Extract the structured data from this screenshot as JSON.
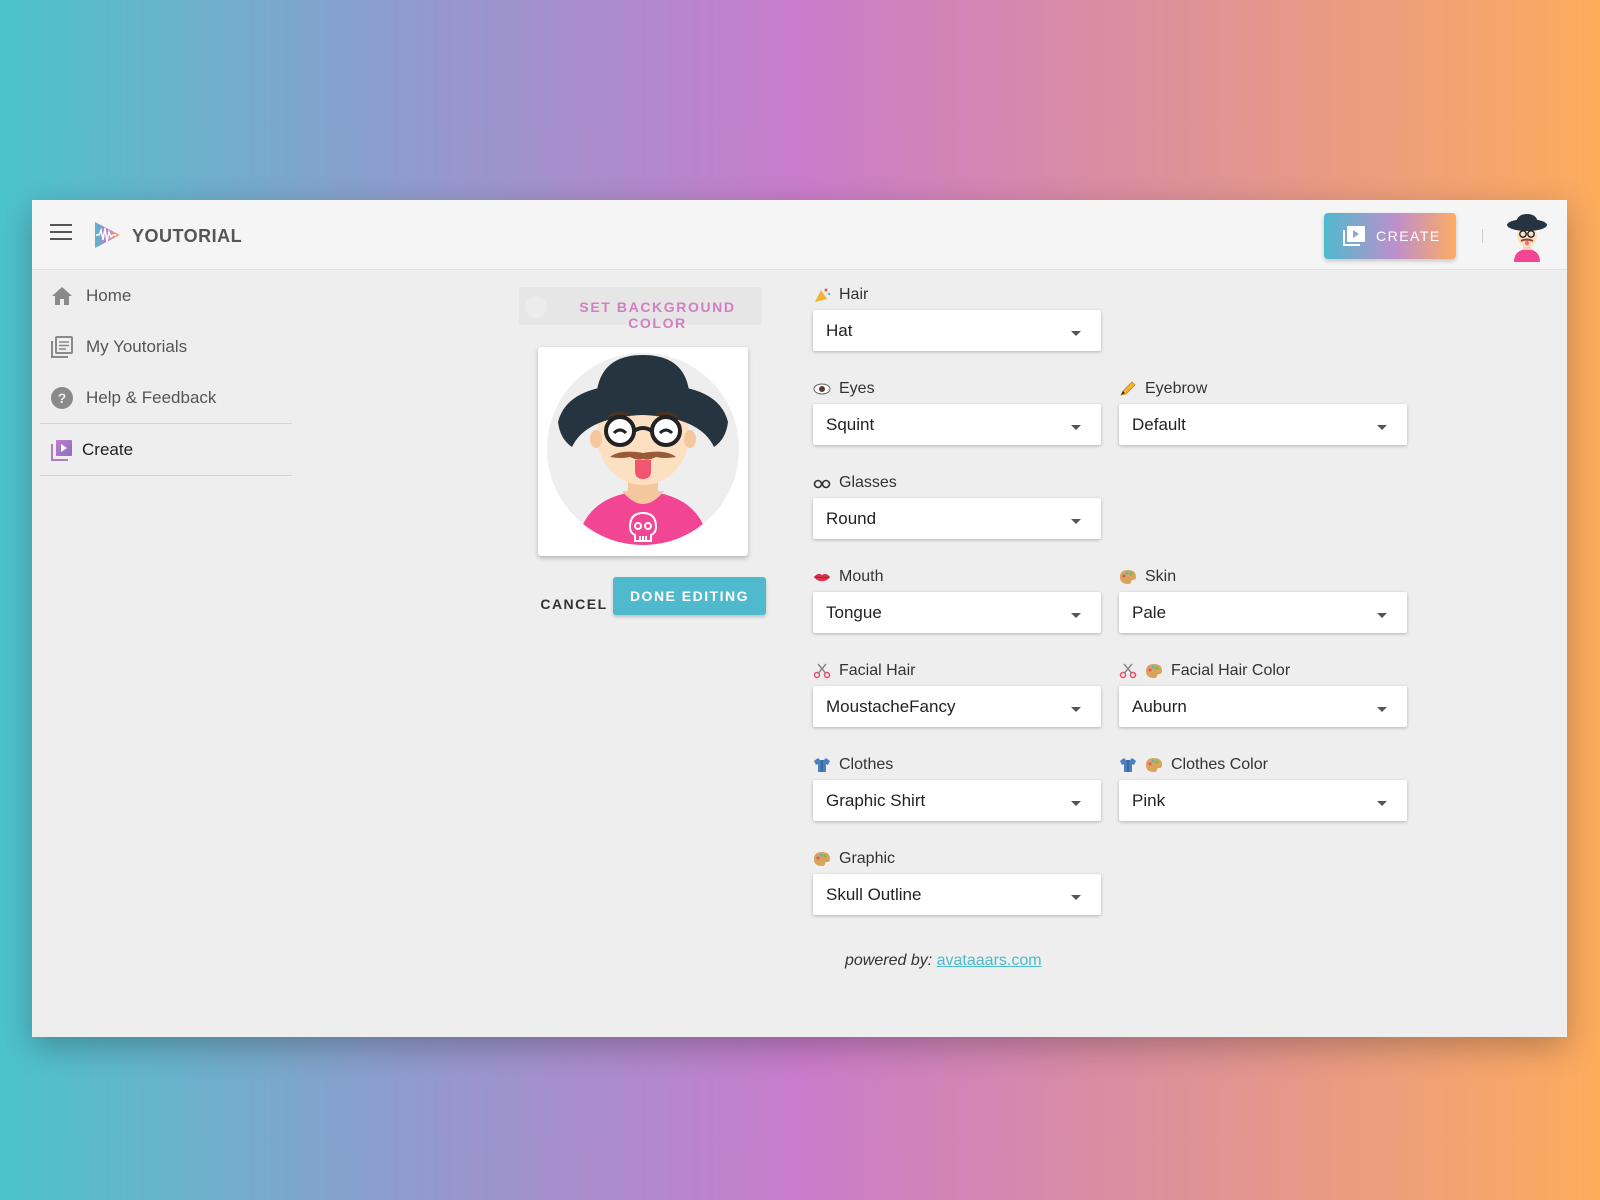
{
  "app": {
    "brand": "YOUTORIAL",
    "create_label": "CREATE"
  },
  "sidebar": {
    "items": [
      {
        "label": "Home",
        "icon": "home-icon"
      },
      {
        "label": "My Youtorials",
        "icon": "library-icon"
      },
      {
        "label": "Help & Feedback",
        "icon": "help-icon"
      },
      {
        "label": "Create",
        "icon": "video-library-icon",
        "active": true
      }
    ]
  },
  "editor": {
    "bg_color_label": "SET BACKGROUND COLOR",
    "cancel_label": "CANCEL",
    "done_label": "DONE EDITING"
  },
  "fields": {
    "hair": {
      "label": "Hair",
      "value": "Hat",
      "icon": "party-icon"
    },
    "eyes": {
      "label": "Eyes",
      "value": "Squint",
      "icon": "eye-icon"
    },
    "eyebrow": {
      "label": "Eyebrow",
      "value": "Default",
      "icon": "pencil-icon"
    },
    "glasses": {
      "label": "Glasses",
      "value": "Round",
      "icon": "glasses-icon"
    },
    "mouth": {
      "label": "Mouth",
      "value": "Tongue",
      "icon": "lips-icon"
    },
    "skin": {
      "label": "Skin",
      "value": "Pale",
      "icon": "palette-icon"
    },
    "facial_hair": {
      "label": "Facial Hair",
      "value": "MoustacheFancy",
      "icon": "scissors-icon"
    },
    "facial_hair_color": {
      "label": "Facial Hair Color",
      "value": "Auburn",
      "icon": "scissors-palette-icon"
    },
    "clothes": {
      "label": "Clothes",
      "value": "Graphic Shirt",
      "icon": "shirt-icon"
    },
    "clothes_color": {
      "label": "Clothes Color",
      "value": "Pink",
      "icon": "shirt-palette-icon"
    },
    "graphic": {
      "label": "Graphic",
      "value": "Skull Outline",
      "icon": "palette-icon"
    }
  },
  "footer": {
    "powered_prefix": "powered by:",
    "powered_link": "avataaars.com"
  },
  "colors": {
    "accent": "#4fb9cd",
    "pink": "#d47ec2",
    "shirt": "#f24594",
    "hat": "#25343e"
  }
}
